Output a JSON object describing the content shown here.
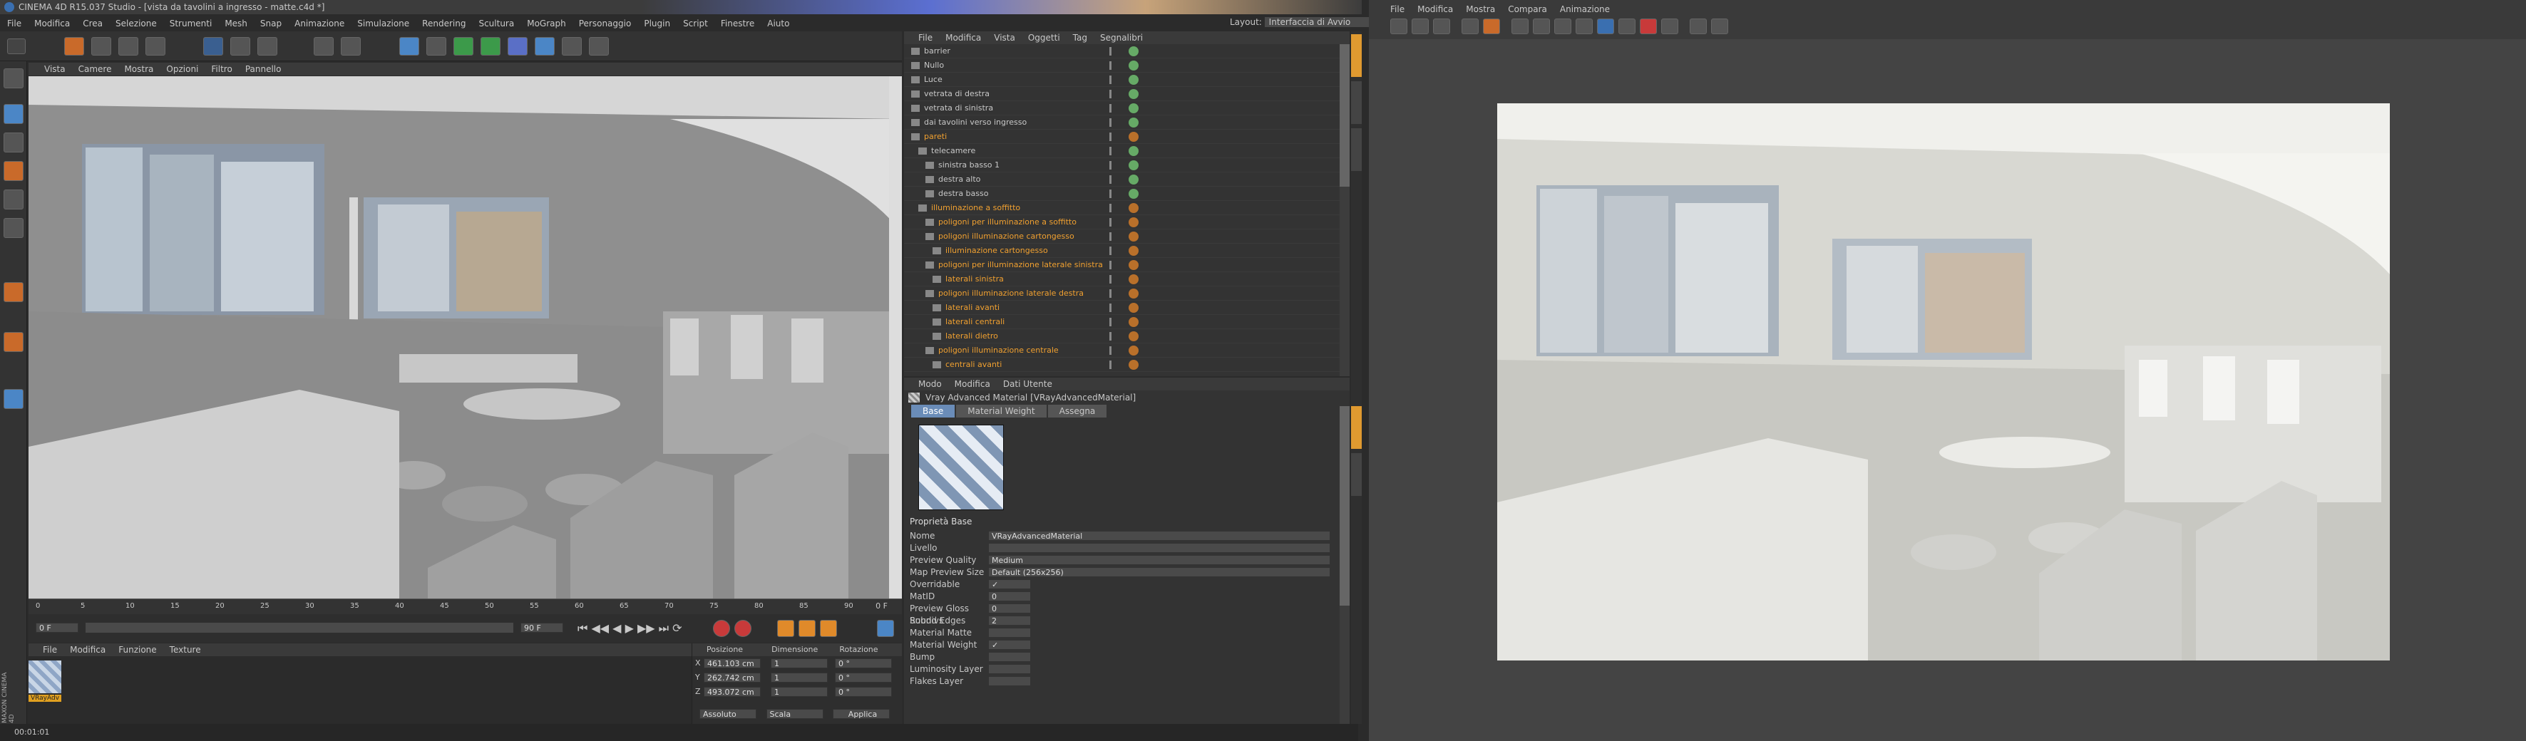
{
  "title": "CINEMA 4D R15.037 Studio - [vista da tavolini a ingresso - matte.c4d *]",
  "menu": [
    "File",
    "Modifica",
    "Crea",
    "Selezione",
    "Strumenti",
    "Mesh",
    "Snap",
    "Animazione",
    "Simulazione",
    "Rendering",
    "Scultura",
    "MoGraph",
    "Personaggio",
    "Plugin",
    "Script",
    "Finestre",
    "Aiuto"
  ],
  "layout_label": "Layout:",
  "layout_value": "Interfaccia di Avvio",
  "vp_menu": [
    "Vista",
    "Camere",
    "Mostra",
    "Opzioni",
    "Filtro",
    "Pannello"
  ],
  "om_menu": [
    "File",
    "Modifica",
    "Vista",
    "Oggetti",
    "Tag",
    "Segnalibri"
  ],
  "objects": [
    {
      "n": "barrier",
      "o": false
    },
    {
      "n": "Nullo",
      "o": false
    },
    {
      "n": "Luce",
      "o": false
    },
    {
      "n": "vetrata di destra",
      "o": false
    },
    {
      "n": "vetrata di sinistra",
      "o": false
    },
    {
      "n": "dai tavolini verso ingresso",
      "o": false
    },
    {
      "n": "pareti",
      "o": true
    },
    {
      "n": "telecamere",
      "o": false
    },
    {
      "n": "sinistra basso 1",
      "o": false
    },
    {
      "n": "destra alto",
      "o": false
    },
    {
      "n": "destra basso",
      "o": false
    },
    {
      "n": "illuminazione a soffitto",
      "o": true
    },
    {
      "n": "poligoni per illuminazione a soffitto",
      "o": true
    },
    {
      "n": "poligoni illuminazione cartongesso",
      "o": true
    },
    {
      "n": "illuminazione cartongesso",
      "o": true
    },
    {
      "n": "poligoni per illuminazione laterale sinistra",
      "o": true
    },
    {
      "n": "laterali sinistra",
      "o": true
    },
    {
      "n": "poligoni illuminazione laterale destra",
      "o": true
    },
    {
      "n": "laterali avanti",
      "o": true
    },
    {
      "n": "laterali centrali",
      "o": true
    },
    {
      "n": "laterali dietro",
      "o": true
    },
    {
      "n": "poligoni illuminazione centrale",
      "o": true
    },
    {
      "n": "centrali avanti",
      "o": true
    }
  ],
  "attr_menu": [
    "Modo",
    "Modifica",
    "Dati Utente"
  ],
  "mat_title": "Vray Advanced Material [VRayAdvancedMaterial]",
  "mat_tabs": [
    "Base",
    "Material Weight",
    "Assegna"
  ],
  "base_props": "Proprietà Base",
  "props": [
    {
      "l": "Nome",
      "v": "VRayAdvancedMaterial"
    },
    {
      "l": "Livello",
      "v": ""
    },
    {
      "l": "Preview Quality",
      "v": "Medium"
    },
    {
      "l": "Map Preview Size",
      "v": "Default (256x256)"
    },
    {
      "l": "Overridable",
      "v": "✓"
    },
    {
      "l": "MatID",
      "v": "0"
    },
    {
      "l": "Preview Gloss Subdivs",
      "v": "0"
    },
    {
      "l": "Round Edges",
      "v": "2"
    },
    {
      "l": "Material Matte",
      "v": ""
    },
    {
      "l": "Material Weight",
      "v": "✓"
    },
    {
      "l": "Bump",
      "v": ""
    },
    {
      "l": "Luminosity Layer",
      "v": ""
    },
    {
      "l": "Flakes Layer",
      "v": ""
    }
  ],
  "timeline_ticks": [
    "0",
    "5",
    "10",
    "15",
    "20",
    "25",
    "30",
    "35",
    "40",
    "45",
    "50",
    "55",
    "60",
    "65",
    "70",
    "75",
    "80",
    "85",
    "90"
  ],
  "frame_end": "0 F",
  "frame_start": "0 F",
  "frame_max": "90 F",
  "mat_menu": [
    "File",
    "Modifica",
    "Funzione",
    "Texture"
  ],
  "mat_name": "VRayAdv",
  "coord_headers": [
    "Posizione",
    "Dimensione",
    "Rotazione"
  ],
  "coords": [
    [
      "X",
      "461.103 cm",
      "1",
      "0 °"
    ],
    [
      "Y",
      "262.742 cm",
      "1",
      "0 °"
    ],
    [
      "Z",
      "493.072 cm",
      "1",
      "0 °"
    ]
  ],
  "coord_btns": [
    "Assoluto",
    "Scala",
    "Applica"
  ],
  "status": "00:01:01",
  "brand": "MAXON CINEMA 4D",
  "rv_menu": [
    "File",
    "Modifica",
    "Mostra",
    "Compara",
    "Animazione"
  ]
}
